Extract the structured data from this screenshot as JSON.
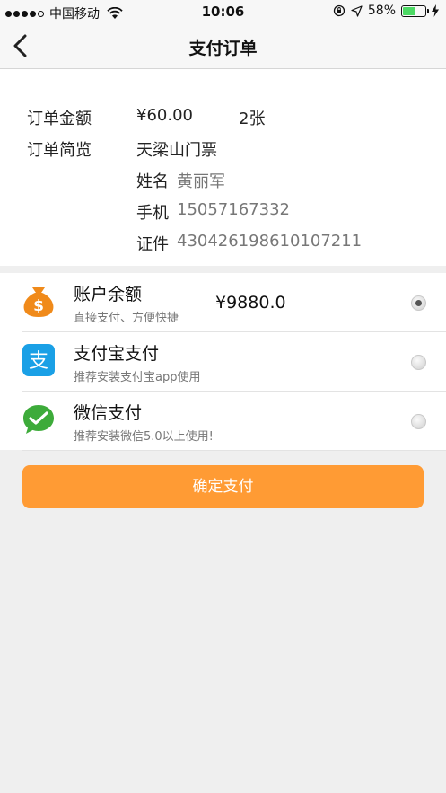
{
  "status_bar": {
    "carrier": "中国移动",
    "time": "10:06",
    "battery": "58%",
    "battery_level": 0.58
  },
  "nav": {
    "title": "支付订单"
  },
  "order": {
    "amount_label": "订单金额",
    "amount": "¥60.00",
    "count": "2张",
    "summary_label": "订单简览",
    "ticket_name": "天梁山门票",
    "name_label": "姓名",
    "name_value": "黄丽军",
    "phone_label": "手机",
    "phone_value": "15057167332",
    "id_label": "证件",
    "id_value": "430426198610107211"
  },
  "payment_methods": [
    {
      "name": "账户余额",
      "desc": "直接支付、方便快捷",
      "amount": "¥9880.0",
      "icon": "money-bag-icon",
      "selected": true
    },
    {
      "name": "支付宝支付",
      "desc": "推荐安装支付宝app使用",
      "icon": "alipay-icon",
      "selected": false
    },
    {
      "name": "微信支付",
      "desc": "推荐安装微信5.0以上使用!",
      "icon": "wechat-icon",
      "selected": false
    }
  ],
  "confirm_label": "确定支付",
  "colors": {
    "accent": "#ff9b34",
    "alipay": "#1aa0e6",
    "wechat": "#3dab3a",
    "money_bag": "#f08a1a"
  }
}
